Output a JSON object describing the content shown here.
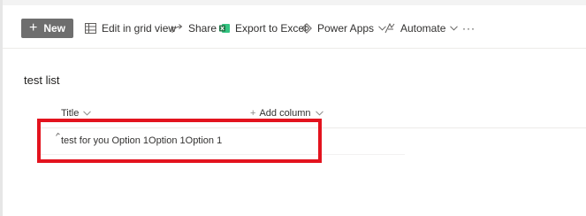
{
  "toolbar": {
    "new_label": "New",
    "edit_grid_label": "Edit in grid view",
    "share_label": "Share",
    "export_label": "Export to Excel",
    "power_apps_label": "Power Apps",
    "automate_label": "Automate",
    "more_label": "···"
  },
  "list": {
    "title": "test list",
    "columns": [
      {
        "label": "Title"
      },
      {
        "label": "Add column",
        "prefix": "+"
      }
    ],
    "rows": [
      {
        "title": "test for you Option 1Option 1Option 1"
      }
    ]
  },
  "colors": {
    "highlight": "#e3131e",
    "new_button_bg": "#6e6e6e",
    "excel_green": "#217346"
  },
  "icons": {
    "new": "plus-icon",
    "edit_grid": "grid-icon",
    "share": "share-icon",
    "export": "excel-icon",
    "power_apps": "power-apps-icon",
    "automate": "automate-icon",
    "more": "ellipsis-icon"
  }
}
